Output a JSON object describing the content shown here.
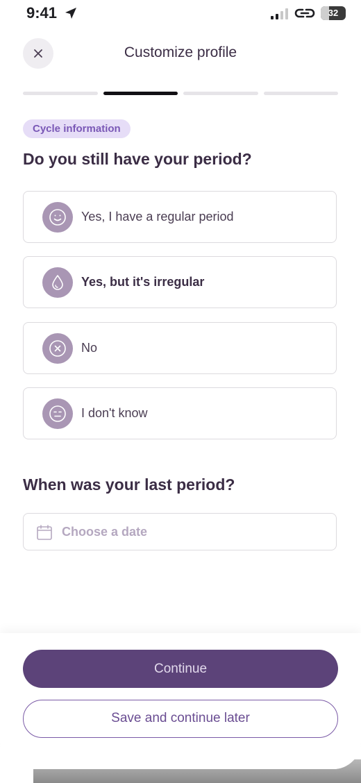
{
  "status_bar": {
    "time": "9:41",
    "battery_level": "32",
    "battery_fill_fraction": 0.32
  },
  "header": {
    "title": "Customize profile",
    "close_icon": "close-icon"
  },
  "progress": {
    "steps_total": 4,
    "current_step": 2
  },
  "section_chip": "Cycle information",
  "question_period": "Do you still have your period?",
  "options": [
    {
      "label": "Yes, I have a regular period",
      "icon": "smile-face-icon",
      "selected": false
    },
    {
      "label": "Yes, but it's irregular",
      "icon": "droplet-icon",
      "selected": true
    },
    {
      "label": "No",
      "icon": "circle-x-icon",
      "selected": false
    },
    {
      "label": "I don't know",
      "icon": "neutral-face-icon",
      "selected": false
    }
  ],
  "question_last_period": "When was your last period?",
  "date_field": {
    "placeholder": "Choose a date",
    "icon": "calendar-icon"
  },
  "footer": {
    "continue_label": "Continue",
    "save_later_label": "Save and continue later"
  },
  "colors": {
    "primary": "#5c4379",
    "chip_bg": "#e6ddf7",
    "chip_text": "#7a58b6",
    "icon_bg": "#a996b4",
    "progress_active": "#121014"
  }
}
